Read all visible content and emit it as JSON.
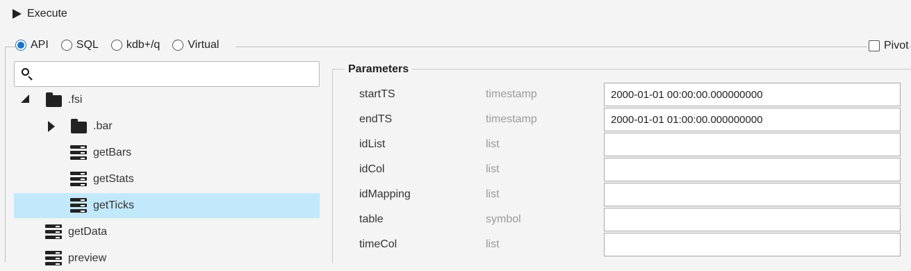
{
  "execute": {
    "label": "Execute"
  },
  "mode": {
    "options": [
      "API",
      "SQL",
      "kdb+/q",
      "Virtual"
    ],
    "selected": "API"
  },
  "pivot": {
    "label": "Pivot",
    "checked": false
  },
  "search": {
    "value": "",
    "placeholder": ""
  },
  "tree": {
    "items": [
      {
        "label": ".fsi",
        "kind": "folder",
        "state": "expanded"
      },
      {
        "label": ".bar",
        "kind": "folder",
        "state": "collapsed"
      },
      {
        "label": "getBars",
        "kind": "function"
      },
      {
        "label": "getStats",
        "kind": "function"
      },
      {
        "label": "getTicks",
        "kind": "function",
        "selected": true
      },
      {
        "label": "getData",
        "kind": "function"
      },
      {
        "label": "preview",
        "kind": "function"
      }
    ]
  },
  "parameters": {
    "title": "Parameters",
    "rows": [
      {
        "name": "startTS",
        "type": "timestamp",
        "value": "2000-01-01 00:00:00.000000000"
      },
      {
        "name": "endTS",
        "type": "timestamp",
        "value": "2000-01-01 01:00:00.000000000"
      },
      {
        "name": "idList",
        "type": "list",
        "value": ""
      },
      {
        "name": "idCol",
        "type": "list",
        "value": ""
      },
      {
        "name": "idMapping",
        "type": "list",
        "value": ""
      },
      {
        "name": "table",
        "type": "symbol",
        "value": ""
      },
      {
        "name": "timeCol",
        "type": "list",
        "value": ""
      }
    ]
  },
  "colors": {
    "accent": "#1a73c8",
    "selection": "#c2e8fb"
  }
}
